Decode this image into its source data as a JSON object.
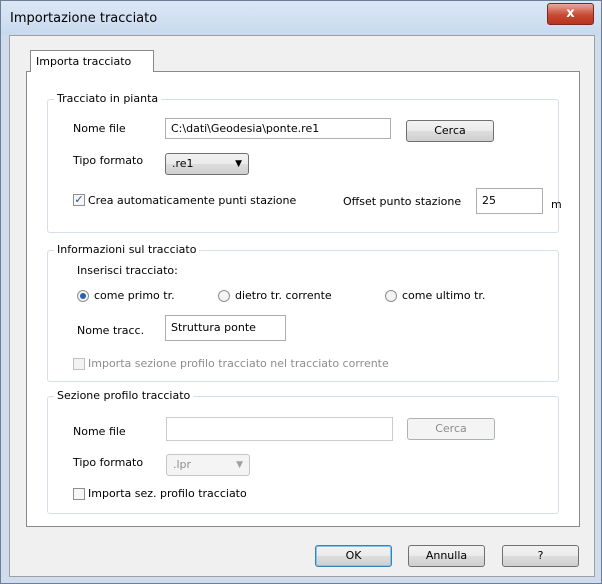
{
  "window": {
    "title": "Importazione tracciato",
    "close_glyph": "x"
  },
  "tab": {
    "label": "Importa tracciato"
  },
  "pianta": {
    "group_title": "Tracciato in pianta",
    "nome_file_label": "Nome file",
    "nome_file_value": "C:\\dati\\Geodesia\\ponte.re1",
    "cerca_label": "Cerca",
    "tipo_formato_label": "Tipo formato",
    "tipo_formato_value": ".re1",
    "crea_punti_label": "Crea automaticamente punti stazione",
    "crea_punti_checked": true,
    "offset_label": "Offset punto stazione",
    "offset_value": "25",
    "offset_unit": "m"
  },
  "informazioni": {
    "group_title": "Informazioni sul tracciato",
    "inserisci_label": "Inserisci tracciato:",
    "radio_options": [
      {
        "label": "come primo tr.",
        "checked": true
      },
      {
        "label": "dietro tr. corrente",
        "checked": false
      },
      {
        "label": "come ultimo tr.",
        "checked": false
      }
    ],
    "nome_tracc_label": "Nome tracc.",
    "nome_tracc_value": "Struttura ponte",
    "importa_sezione_label": "Importa sezione profilo tracciato nel tracciato corrente"
  },
  "sezione": {
    "group_title": "Sezione profilo tracciato",
    "nome_file_label": "Nome file",
    "nome_file_value": "",
    "cerca_label": "Cerca",
    "tipo_formato_label": "Tipo formato",
    "tipo_formato_value": ".lpr",
    "importa_sez_label": "Importa sez. profilo tracciato"
  },
  "footer": {
    "ok_label": "OK",
    "annulla_label": "Annulla",
    "help_label": "?"
  },
  "icons": {
    "close": "close-icon",
    "dropdown": "chevron-down-icon",
    "check": "checkmark-icon"
  },
  "colors": {
    "titlebar": "#cfdced",
    "close_button": "#c74a34",
    "accent": "#2b5fb0"
  }
}
